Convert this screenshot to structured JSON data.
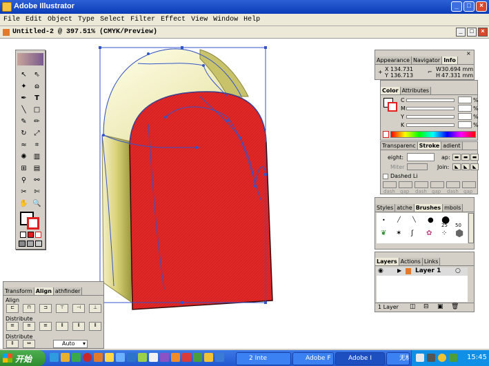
{
  "app": {
    "title": "Adobe Illustrator",
    "window_buttons": [
      "_",
      "□",
      "×"
    ]
  },
  "menu": [
    "File",
    "Edit",
    "Object",
    "Type",
    "Select",
    "Filter",
    "Effect",
    "View",
    "Window",
    "Help"
  ],
  "document": {
    "title": "Untitled-2 @ 397.51% (CMYK/Preview)"
  },
  "info_panel": {
    "tabs": [
      "Appearance",
      "Navigator",
      "Info"
    ],
    "x_label": "X",
    "x_value": "134.731",
    "y_label": "Y",
    "y_value": "136.713",
    "w_label": "W",
    "w_value": "30.694 mm",
    "h_label": "H",
    "h_value": "47.331 mm"
  },
  "color_panel": {
    "tabs": [
      "Color",
      "Attributes"
    ],
    "channels": [
      "C",
      "M",
      "Y",
      "K"
    ],
    "percent": "%"
  },
  "stroke_panel": {
    "tabs": [
      "Transparenc",
      "Stroke",
      "adient"
    ],
    "weight_label": "eight:",
    "cap_label": "ap:",
    "miter_label": "Miter",
    "join_label": "Join:",
    "dashed_label": "Dashed Li",
    "dash_labels": [
      "dash",
      "gap",
      "dash",
      "gap",
      "dash",
      "gap"
    ]
  },
  "brushes_panel": {
    "tabs": [
      "Styles",
      "atche",
      "Brushes",
      "mbols"
    ],
    "sizes": [
      "25",
      "50"
    ]
  },
  "layers_panel": {
    "tabs": [
      "Layers",
      "Actions",
      "Links"
    ],
    "layer_name": "Layer 1",
    "footer": "1 Layer"
  },
  "align_panel": {
    "tabs": [
      "Transform",
      "Align",
      "athfinder"
    ],
    "align_label": "Align",
    "distribute_label": "Distribute",
    "distribute_spacing_label": "Distribute",
    "auto_value": "Auto"
  },
  "taskbar": {
    "start": "开始",
    "tasks": [
      "2 Inte",
      "Adobe F",
      "Adobe I",
      "无标题"
    ],
    "clock": "15:45"
  },
  "colors": {
    "fill": "#e02020",
    "stroke": "#3355cc",
    "accent": "#0a3cb8"
  }
}
